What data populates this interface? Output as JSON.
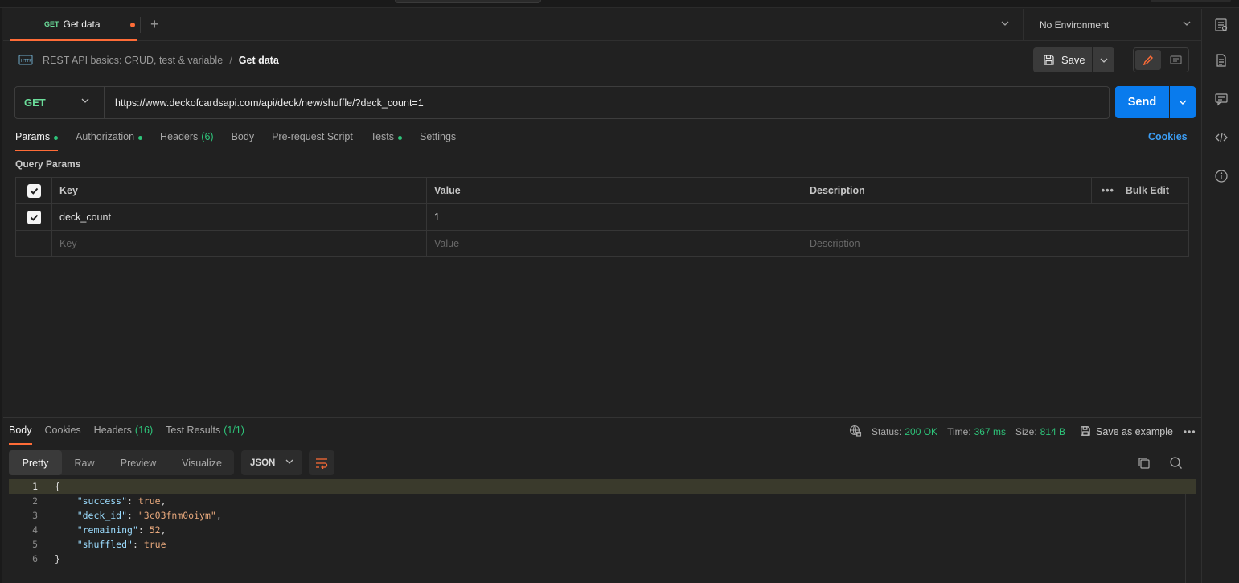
{
  "tabbar": {
    "active_tab": {
      "method": "GET",
      "name": "Get data"
    },
    "environment": "No Environment"
  },
  "breadcrumb": {
    "collection": "REST API basics: CRUD, test & variable",
    "separator": "/",
    "request": "Get data"
  },
  "toolbar": {
    "save_label": "Save"
  },
  "request": {
    "method": "GET",
    "url": "https://www.deckofcardsapi.com/api/deck/new/shuffle/?deck_count=1",
    "send_label": "Send"
  },
  "request_tabs": [
    {
      "label": "Params",
      "active": true,
      "dot": true
    },
    {
      "label": "Authorization",
      "dot": true
    },
    {
      "label": "Headers",
      "count": "(6)"
    },
    {
      "label": "Body"
    },
    {
      "label": "Pre-request Script"
    },
    {
      "label": "Tests",
      "dot": true
    },
    {
      "label": "Settings"
    }
  ],
  "cookies_link": "Cookies",
  "query_params": {
    "title": "Query Params",
    "headers": {
      "key": "Key",
      "value": "Value",
      "description": "Description",
      "bulk": "Bulk Edit"
    },
    "rows": [
      {
        "key": "deck_count",
        "value": "1",
        "description": "",
        "checked": true
      }
    ],
    "placeholders": {
      "key": "Key",
      "value": "Value",
      "description": "Description"
    }
  },
  "response": {
    "tabs": [
      {
        "label": "Body",
        "active": true
      },
      {
        "label": "Cookies"
      },
      {
        "label": "Headers",
        "count": "(16)"
      },
      {
        "label": "Test Results",
        "count": "(1/1)"
      }
    ],
    "status_label": "Status:",
    "status": "200 OK",
    "time_label": "Time:",
    "time": "367 ms",
    "size_label": "Size:",
    "size": "814 B",
    "save_example": "Save as example",
    "views": [
      "Pretty",
      "Raw",
      "Preview",
      "Visualize"
    ],
    "format": "JSON",
    "code_lines": [
      {
        "n": "1",
        "text": "{"
      },
      {
        "n": "2",
        "key": "\"success\"",
        "val": "true",
        "trail": ","
      },
      {
        "n": "3",
        "key": "\"deck_id\"",
        "val": "\"3c03fnm0oiym\"",
        "trail": ","
      },
      {
        "n": "4",
        "key": "\"remaining\"",
        "val": "52",
        "trail": ","
      },
      {
        "n": "5",
        "key": "\"shuffled\"",
        "val": "true",
        "trail": ""
      },
      {
        "n": "6",
        "text": "}"
      }
    ]
  },
  "colors": {
    "accent": "#ff6c37",
    "send": "#097bed",
    "get": "#6bdd9a",
    "ok": "#2ec47a"
  }
}
